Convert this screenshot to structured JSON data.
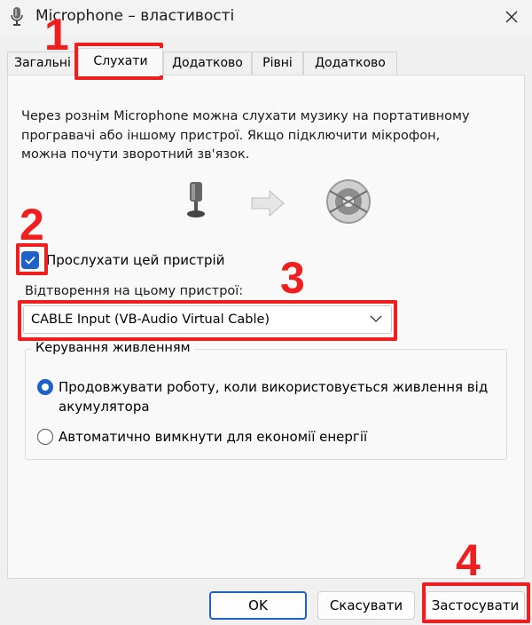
{
  "window": {
    "title": "Microphone – властивості",
    "icon": "microphone-icon",
    "close_icon": "close-icon"
  },
  "tabs": [
    {
      "label": "Загальні",
      "active": false
    },
    {
      "label": "Слухати",
      "active": true
    },
    {
      "label": "Додатково",
      "active": false
    },
    {
      "label": "Рівні",
      "active": false
    },
    {
      "label": "Додатково",
      "active": false
    }
  ],
  "listen": {
    "description": "Через рознім Microphone можна слухати музику на портативному програвачі або іншому пристрої. Якщо підключити мікрофон, можна почути зворотний зв'язок.",
    "illustration": [
      "microphone-icon",
      "arrow-right-icon",
      "speaker-icon"
    ],
    "checkbox_label": "Прослухати цей пристрій",
    "checkbox_checked": true,
    "playback_label": "Відтворення на цьому пристрої:",
    "playback_device": "CABLE Input (VB-Audio Virtual Cable)"
  },
  "power": {
    "title": "Керування живленням",
    "options": [
      {
        "label": "Продовжувати роботу, коли використовується живлення від акумулятора",
        "selected": true
      },
      {
        "label": "Автоматично вимкнути для економії енергії",
        "selected": false
      }
    ]
  },
  "buttons": {
    "ok": "OK",
    "cancel": "Скасувати",
    "apply": "Застосувати"
  },
  "annotations": {
    "color": "#ef1f1f",
    "labels": [
      "1",
      "2",
      "3",
      "4"
    ]
  },
  "colors": {
    "accent": "#1e61c8"
  }
}
